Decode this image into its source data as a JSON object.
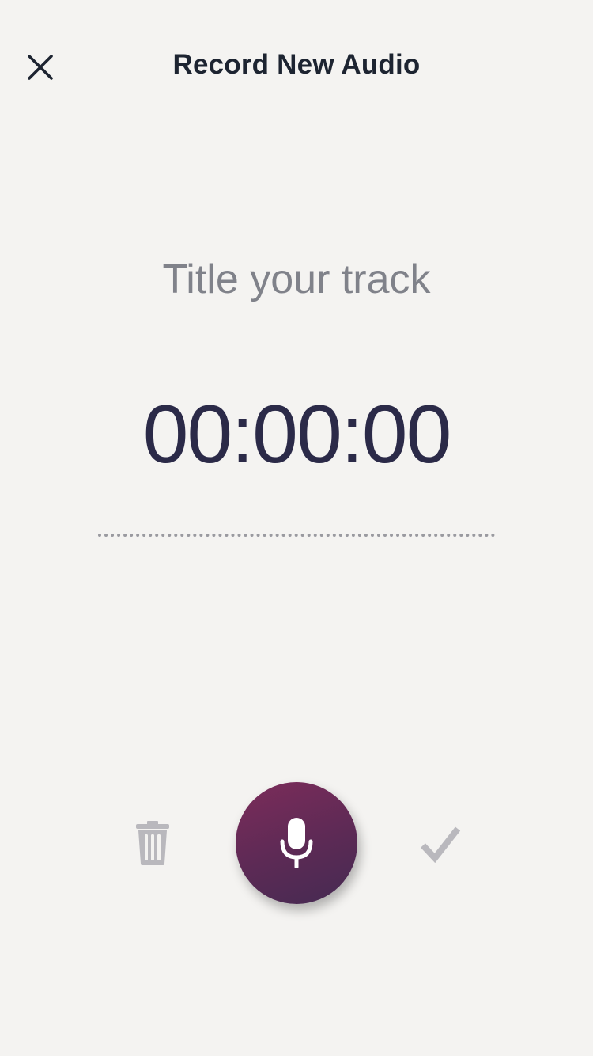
{
  "header": {
    "title": "Record New Audio",
    "close_icon": "close-icon"
  },
  "track": {
    "title_placeholder": "Title your track",
    "title_value": ""
  },
  "timer": {
    "elapsed": "00:00:00"
  },
  "controls": {
    "delete_icon": "trash-icon",
    "record_icon": "microphone-icon",
    "confirm_icon": "checkmark-icon"
  },
  "colors": {
    "background": "#f4f3f1",
    "title_text": "#1d2431",
    "timer_text": "#2b2a48",
    "placeholder_text": "#80828a",
    "record_gradient_start": "#7c2c5a",
    "record_gradient_end": "#452a52",
    "disabled_icon": "#b9b8bd"
  }
}
